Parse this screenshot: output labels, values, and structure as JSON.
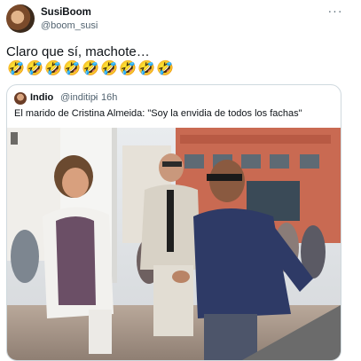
{
  "tweet": {
    "author_name": "SusiBoom",
    "author_handle": "@boom_susi",
    "more_label": "···",
    "text": "Claro que sí, machote…",
    "emojis": [
      "🤣",
      "🤣",
      "🤣",
      "🤣",
      "🤣",
      "🤣",
      "🤣",
      "🤣",
      "🤣"
    ]
  },
  "quoted_tweet": {
    "author_name": "Indio",
    "author_handle": "@inditipi",
    "separator": "·",
    "time": "16h",
    "text": "El marido de Cristina Almeida: \"Soy la envidia de todos los fachas\""
  },
  "colors": {
    "text_primary": "#0f1419",
    "text_secondary": "#536471",
    "border": "#cfd9de"
  }
}
